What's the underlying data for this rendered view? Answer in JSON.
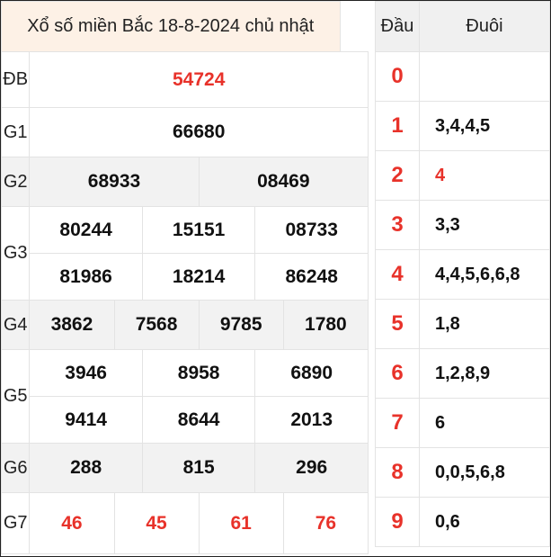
{
  "title": "Xổ số miền Bắc 18-8-2024 chủ nhật",
  "prizes": {
    "db": {
      "label": "ĐB",
      "values": [
        "54724"
      ]
    },
    "g1": {
      "label": "G1",
      "values": [
        "66680"
      ]
    },
    "g2": {
      "label": "G2",
      "values": [
        "68933",
        "08469"
      ]
    },
    "g3": {
      "label": "G3",
      "values": [
        "80244",
        "15151",
        "08733",
        "81986",
        "18214",
        "86248"
      ]
    },
    "g4": {
      "label": "G4",
      "values": [
        "3862",
        "7568",
        "9785",
        "1780"
      ]
    },
    "g5": {
      "label": "G5",
      "values": [
        "3946",
        "8958",
        "6890",
        "9414",
        "8644",
        "2013"
      ]
    },
    "g6": {
      "label": "G6",
      "values": [
        "288",
        "815",
        "296"
      ]
    },
    "g7": {
      "label": "G7",
      "values": [
        "46",
        "45",
        "61",
        "76"
      ]
    }
  },
  "loto": {
    "head_label": "Đầu",
    "tail_label": "Đuôi",
    "rows": [
      {
        "head": "0",
        "tail": ""
      },
      {
        "head": "1",
        "tail": "3,4,4,5"
      },
      {
        "head": "2",
        "tail": "4"
      },
      {
        "head": "3",
        "tail": "3,3"
      },
      {
        "head": "4",
        "tail": "4,4,5,6,6,8"
      },
      {
        "head": "5",
        "tail": "1,8"
      },
      {
        "head": "6",
        "tail": "1,2,8,9"
      },
      {
        "head": "7",
        "tail": "6"
      },
      {
        "head": "8",
        "tail": "0,0,5,6,8"
      },
      {
        "head": "9",
        "tail": "0,6"
      }
    ]
  },
  "colors": {
    "accent_red": "#e8322a",
    "title_bg": "#fdf1e6",
    "shade_bg": "#f2f2f2"
  }
}
